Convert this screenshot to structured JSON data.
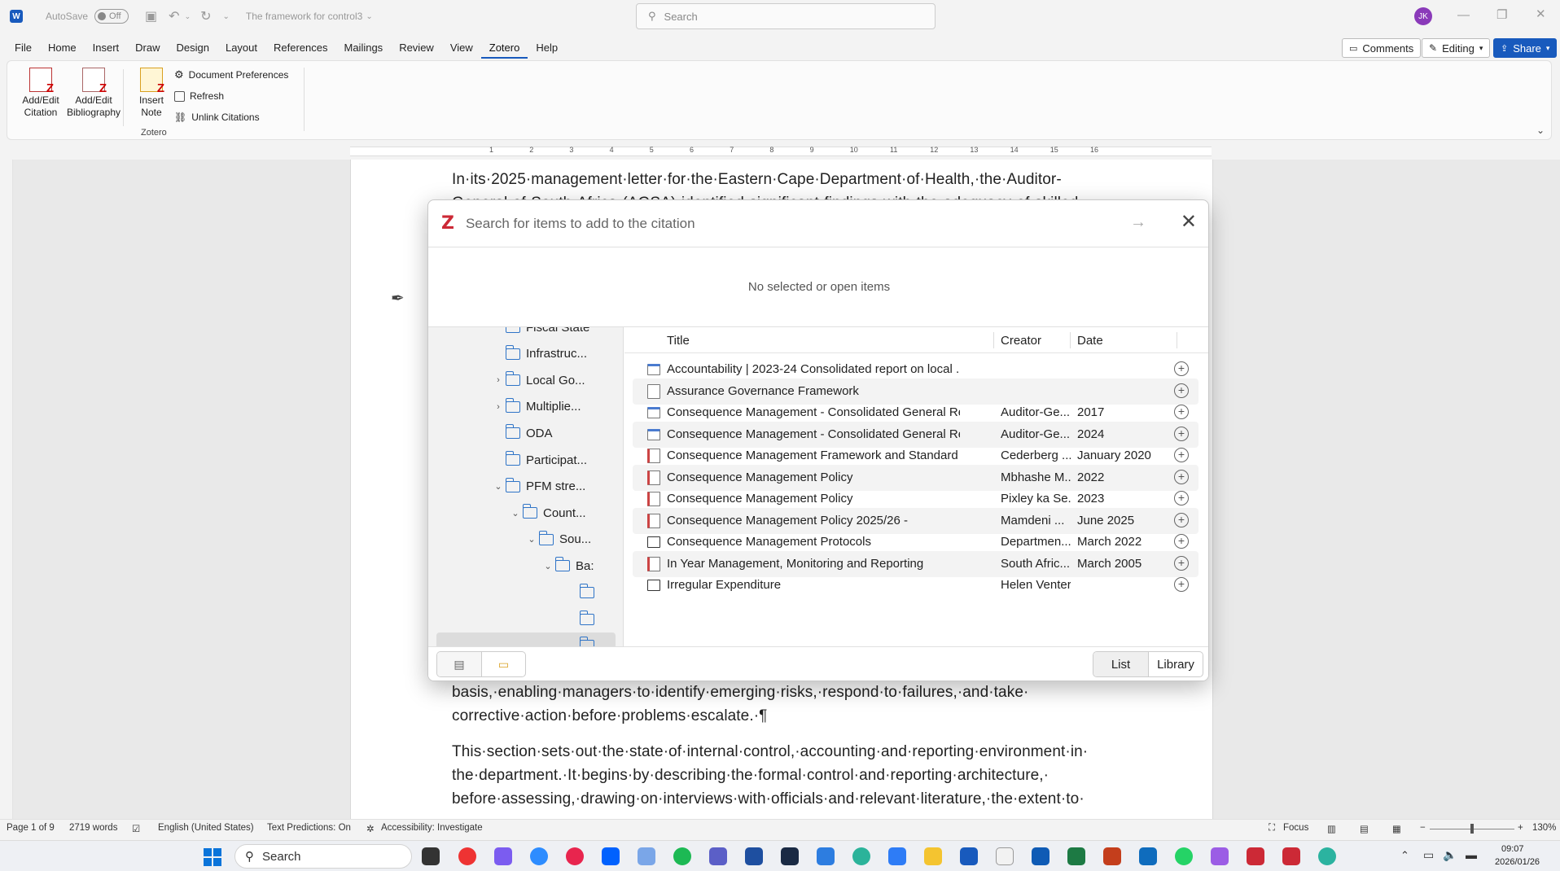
{
  "titlebar": {
    "autosave_label": "AutoSave",
    "autosave_state": "Off",
    "doc_title": "The framework for control3",
    "search_placeholder": "Search",
    "user_initials": "JK"
  },
  "menu": {
    "tabs": [
      "File",
      "Home",
      "Insert",
      "Draw",
      "Design",
      "Layout",
      "References",
      "Mailings",
      "Review",
      "View",
      "Zotero",
      "Help"
    ],
    "active_tab": "Zotero",
    "comments_label": "Comments",
    "editing_label": "Editing",
    "share_label": "Share"
  },
  "ribbon": {
    "add_edit_citation": [
      "Add/Edit",
      "Citation"
    ],
    "add_edit_bibliography": [
      "Add/Edit",
      "Bibliography"
    ],
    "insert_note": [
      "Insert",
      "Note"
    ],
    "document_preferences": "Document Preferences",
    "refresh": "Refresh",
    "unlink_citations": "Unlink Citations",
    "group_label": "Zotero"
  },
  "ruler": {
    "numbers": [
      "1",
      "2",
      "3",
      "4",
      "5",
      "6",
      "7",
      "8",
      "9",
      "10",
      "11",
      "12",
      "13",
      "14",
      "15",
      "16"
    ]
  },
  "document": {
    "line_1": "In·its·2025·management·letter·for·the·Eastern·Cape·Department·of·Health,·the·Auditor-",
    "line_2": "General·of·South·Africa·(AGSA)·identified·significant·findings·with·the·adequacy·of·skilled·",
    "line_3": "basis,·enabling·managers·to·identify·emerging·risks,·respond·to·failures,·and·take·",
    "line_4": "corrective·action·before·problems·escalate.·¶",
    "line_5": "This·section·sets·out·the·state·of·internal·control,·accounting·and·reporting·environment·in·",
    "line_6": "the·department.·It·begins·by·describing·the·formal·control·and·reporting·architecture,·",
    "line_7": "before·assessing,·drawing·on·interviews·with·officials·and·relevant·literature,·the·extent·to·"
  },
  "zotero_dialog": {
    "search_placeholder": "Search for items to add to the citation",
    "empty_message": "No selected or open items",
    "tree": [
      {
        "label": "Fiscal State",
        "indent": 0,
        "twisty": ""
      },
      {
        "label": "Infrastruc...",
        "indent": 0,
        "twisty": ""
      },
      {
        "label": "Local Go...",
        "indent": 0,
        "twisty": "›"
      },
      {
        "label": "Multiplie...",
        "indent": 0,
        "twisty": "›"
      },
      {
        "label": "ODA",
        "indent": 0,
        "twisty": ""
      },
      {
        "label": "Participat...",
        "indent": 0,
        "twisty": ""
      },
      {
        "label": "PFM stre...",
        "indent": 0,
        "twisty": "⌄"
      },
      {
        "label": "Count...",
        "indent": 1,
        "twisty": "⌄"
      },
      {
        "label": "Sou...",
        "indent": 2,
        "twisty": "⌄"
      },
      {
        "label": "Ba:",
        "indent": 3,
        "twisty": "⌄"
      },
      {
        "label": "",
        "indent": 4,
        "twisty": ""
      },
      {
        "label": "",
        "indent": 4,
        "twisty": ""
      },
      {
        "label": "",
        "indent": 4,
        "twisty": "⌄"
      }
    ],
    "columns": {
      "title": "Title",
      "creator": "Creator",
      "date": "Date"
    },
    "items": [
      {
        "type": "web",
        "title": "Accountability | 2023-24 Consolidated report on local ...",
        "creator": "",
        "date": ""
      },
      {
        "type": "doc",
        "title": "Assurance Governance Framework",
        "creator": "",
        "date": ""
      },
      {
        "type": "web",
        "title": "Consequence Management - Consolidated General Re...",
        "creator": "Auditor-Ge...",
        "date": "2017"
      },
      {
        "type": "web",
        "title": "Consequence Management - Consolidated General Re...",
        "creator": "Auditor-Ge...",
        "date": "2024"
      },
      {
        "type": "rep",
        "title": "Consequence Management Framework and Standard ...",
        "creator": "Cederberg ...",
        "date": "January 2020"
      },
      {
        "type": "rep",
        "title": "Consequence Management Policy",
        "creator": "Mbhashe M...",
        "date": "2022"
      },
      {
        "type": "rep",
        "title": "Consequence Management Policy",
        "creator": "Pixley ka Se...",
        "date": "2023"
      },
      {
        "type": "rep",
        "title": "Consequence Management Policy 2025/26 -",
        "creator": "Mamdeni ...",
        "date": "June 2025"
      },
      {
        "type": "pres",
        "title": "Consequence Management Protocols",
        "creator": "Departmen...",
        "date": "March 2022"
      },
      {
        "type": "rep",
        "title": "In Year Management, Monitoring and Reporting",
        "creator": "South Afric...",
        "date": "March 2005"
      },
      {
        "type": "pres",
        "title": "Irregular Expenditure",
        "creator": "Helen Venter",
        "date": ""
      }
    ],
    "view_list": "List",
    "view_library": "Library"
  },
  "statusbar": {
    "page": "Page 1 of 9",
    "words": "2719 words",
    "language": "English (United States)",
    "predictions": "Text Predictions: On",
    "accessibility": "Accessibility: Investigate",
    "focus": "Focus",
    "zoom": "130%"
  },
  "taskbar": {
    "search_label": "Search",
    "time": "09:07",
    "date": "2026/01/26"
  },
  "colors": {
    "word_blue": "#185abd",
    "zotero_red": "#cc2936",
    "folder_blue": "#2f74c7"
  }
}
